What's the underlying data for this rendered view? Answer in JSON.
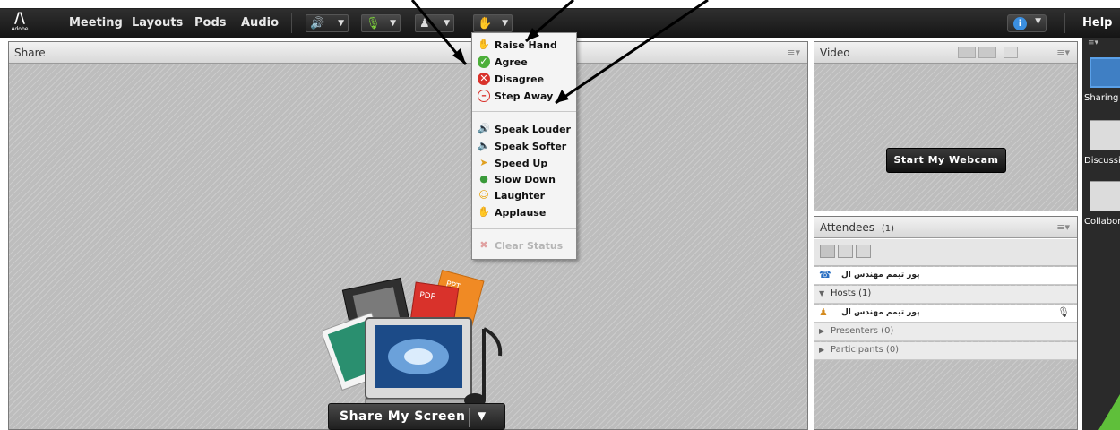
{
  "menubar": {
    "logo_text": "Adobe",
    "items": [
      "Meeting",
      "Layouts",
      "Pods",
      "Audio"
    ],
    "help": "Help"
  },
  "share_pod": {
    "title": "Share",
    "art_labels": [
      "PPT",
      "PDF"
    ],
    "button_label": "Share My Screen"
  },
  "video_pod": {
    "title": "Video",
    "webcam_button": "Start My Webcam"
  },
  "attendees_pod": {
    "title": "Attendees",
    "count": "(1)",
    "top_name": "پور تیمم مهندس ال",
    "hosts_label": "Hosts (1)",
    "host_name": "پور تیمم مهندس ال",
    "presenters_label": "Presenters (0)",
    "participants_label": "Participants (0)"
  },
  "layouts": {
    "items": [
      "Sharing",
      "Discussion",
      "Collaboration"
    ]
  },
  "status_menu": {
    "group1": [
      "Raise Hand",
      "Agree",
      "Disagree",
      "Step Away"
    ],
    "group2": [
      "Speak Louder",
      "Speak Softer",
      "Speed Up",
      "Slow Down",
      "Laughter",
      "Applause"
    ],
    "clear": "Clear Status"
  },
  "colors": {
    "menubar": "#1e1e1e",
    "pod_background": "#bdbdbd",
    "accent_blue": "#3f7fc4",
    "green": "#7ed23b"
  }
}
